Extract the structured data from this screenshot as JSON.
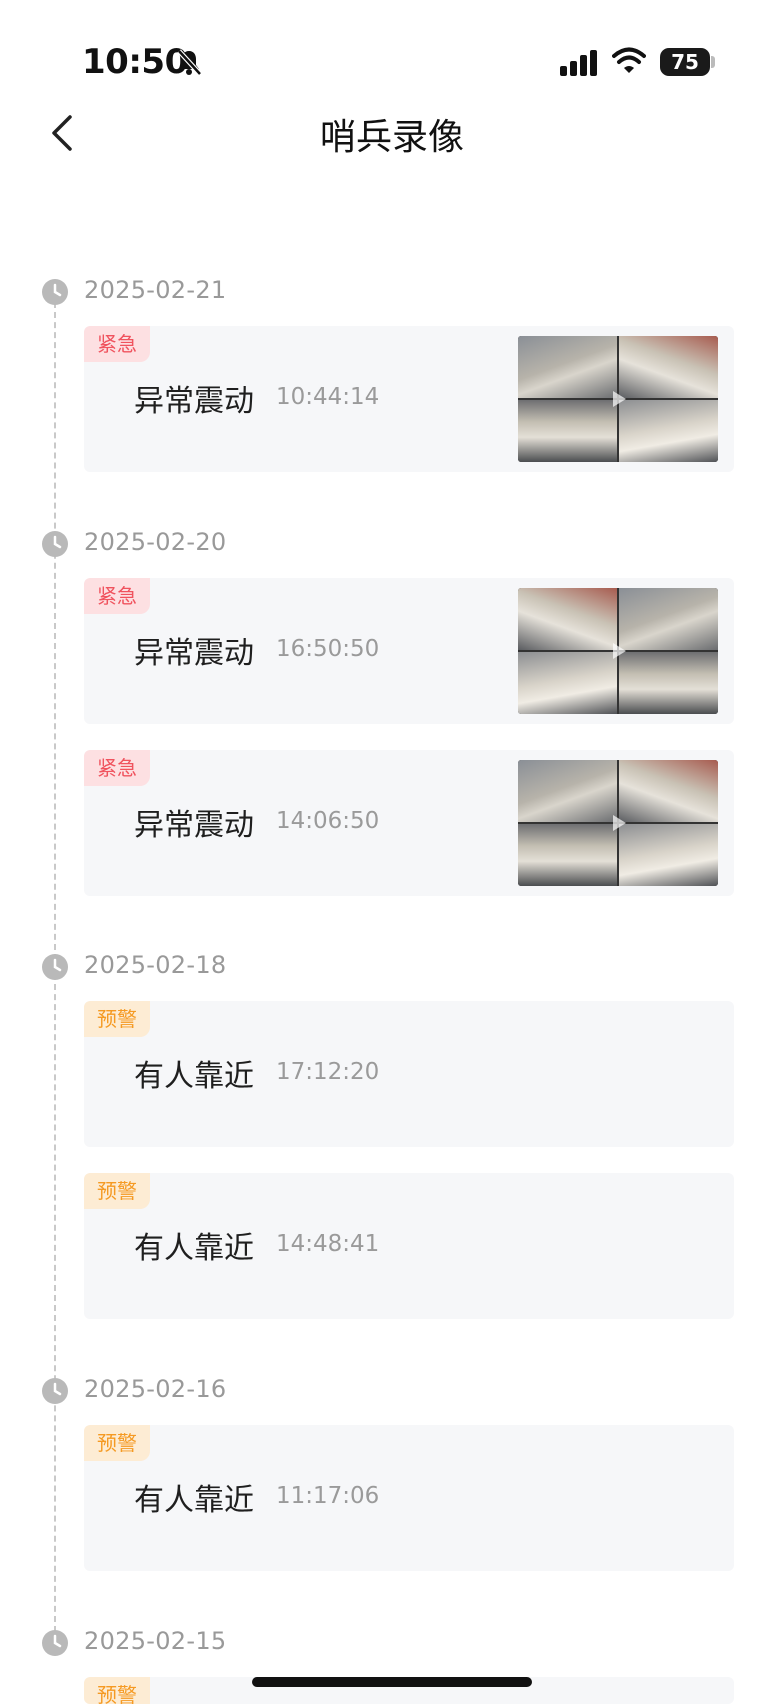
{
  "status_bar": {
    "time": "10:50",
    "battery": "75"
  },
  "nav": {
    "title": "哨兵录像"
  },
  "groups": [
    {
      "date": "2025-02-21",
      "items": [
        {
          "tag": "紧急",
          "event": "异常震动",
          "time": "10:44:14"
        }
      ]
    },
    {
      "date": "2025-02-20",
      "items": [
        {
          "tag": "紧急",
          "event": "异常震动",
          "time": "16:50:50"
        },
        {
          "tag": "紧急",
          "event": "异常震动",
          "time": "14:06:50"
        }
      ]
    },
    {
      "date": "2025-02-18",
      "items": [
        {
          "tag": "预警",
          "event": "有人靠近",
          "time": "17:12:20"
        },
        {
          "tag": "预警",
          "event": "有人靠近",
          "time": "14:48:41"
        }
      ]
    },
    {
      "date": "2025-02-16",
      "items": [
        {
          "tag": "预警",
          "event": "有人靠近",
          "time": "11:17:06"
        }
      ]
    },
    {
      "date": "2025-02-15",
      "items": [
        {
          "tag": "预警"
        }
      ]
    }
  ],
  "colors": {
    "urgent": "#f0535e",
    "warning": "#f59a23",
    "date": "#999999"
  },
  "icons": [
    "bell-slash-icon",
    "signal-icon",
    "wifi-icon",
    "battery-icon",
    "back-chevron-icon",
    "clock-icon",
    "play-icon"
  ]
}
